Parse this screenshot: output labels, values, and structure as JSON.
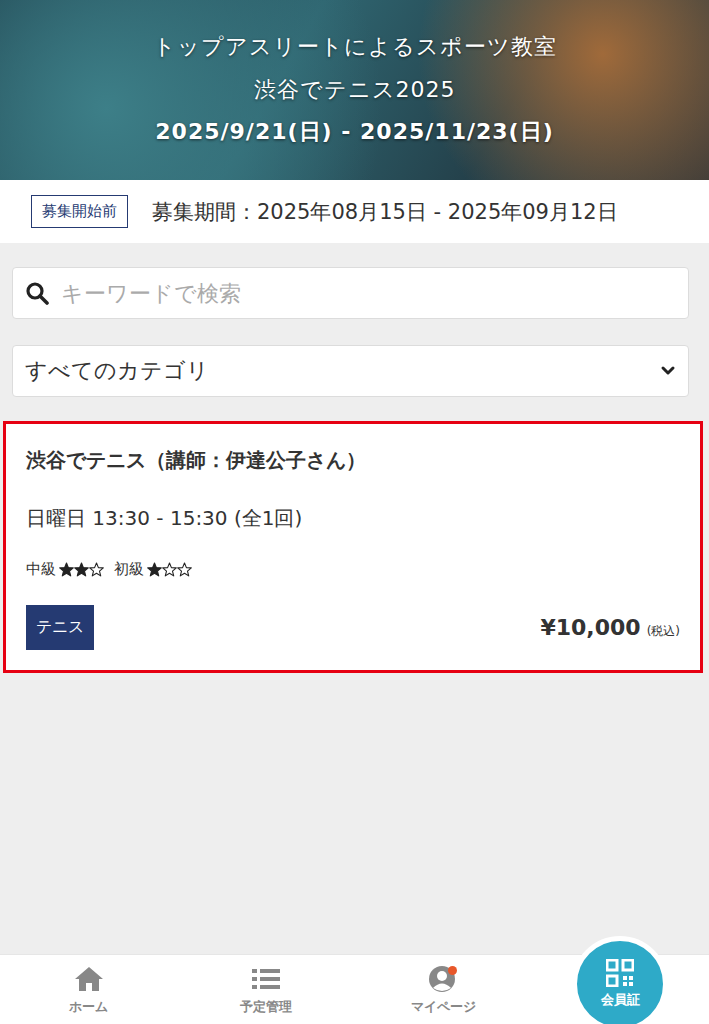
{
  "header": {
    "subtitle": "トップアスリートによるスポーツ教室",
    "title": "渋谷でテニス2025",
    "dates": "2025/9/21(日) - 2025/11/23(日)"
  },
  "recruitment": {
    "status": "募集開始前",
    "period": "募集期間：2025年08月15日 - 2025年09月12日"
  },
  "search": {
    "placeholder": "キーワードで検索"
  },
  "category": {
    "value": "すべてのカテゴリ"
  },
  "courses": [
    {
      "title": "渋谷でテニス（講師：伊達公子さん）",
      "schedule": "日曜日 13:30 - 15:30 (全1回)",
      "levels": [
        {
          "label": "中級",
          "stars": 2
        },
        {
          "label": "初級",
          "stars": 1
        }
      ],
      "tag": "テニス",
      "price": "¥10,000",
      "tax": "(税込)",
      "highlighted": true
    }
  ],
  "nav": [
    {
      "label": "ホーム",
      "kind": "normal",
      "badge": false
    },
    {
      "label": "予定管理",
      "kind": "normal",
      "badge": false
    },
    {
      "label": "マイページ",
      "kind": "normal",
      "badge": true
    },
    {
      "label": "会員証",
      "kind": "featured",
      "badge": false
    }
  ]
}
